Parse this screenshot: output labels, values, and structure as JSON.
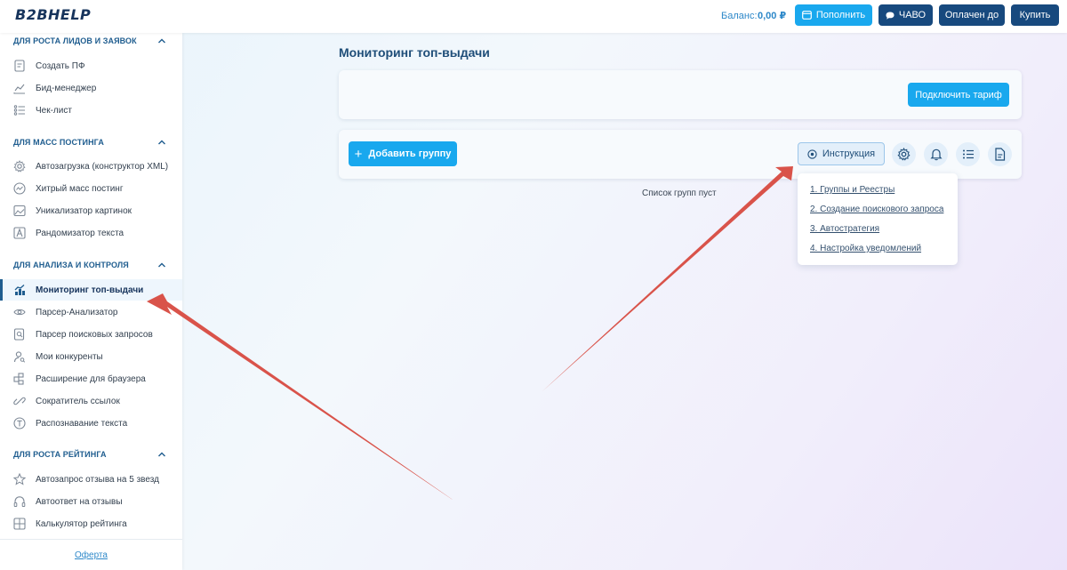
{
  "header": {
    "logo": "B2BHELP",
    "balance_label": "Баланс:",
    "balance_value": "0,00 ₽",
    "topup_label": "Пополнить",
    "faq_label": "ЧАВО",
    "paid_label": "Оплачен до",
    "buy_label": "Купить"
  },
  "sidebar": {
    "sections": [
      {
        "title": "ДЛЯ РОСТА ЛИДОВ И ЗАЯВОК",
        "items": [
          {
            "label": "Создать ПФ",
            "icon": "document-icon"
          },
          {
            "label": "Бид-менеджер",
            "icon": "chart-line-icon"
          },
          {
            "label": "Чек-лист",
            "icon": "checklist-icon"
          }
        ]
      },
      {
        "title": "ДЛЯ МАСС ПОСТИНГА",
        "items": [
          {
            "label": "Автозагрузка (конструктор XML)",
            "icon": "gear-icon"
          },
          {
            "label": "Хитрый масс постинг",
            "icon": "pulse-icon"
          },
          {
            "label": "Уникализатор картинок",
            "icon": "image-icon"
          },
          {
            "label": "Рандомизатор текста",
            "icon": "letter-a-icon"
          }
        ]
      },
      {
        "title": "ДЛЯ АНАЛИЗА И КОНТРОЛЯ",
        "items": [
          {
            "label": "Мониторинг топ-выдачи",
            "icon": "monitoring-icon",
            "active": true
          },
          {
            "label": "Парсер-Анализатор",
            "icon": "eye-icon"
          },
          {
            "label": "Парсер поисковых запросов",
            "icon": "search-document-icon"
          },
          {
            "label": "Мои конкуренты",
            "icon": "user-search-icon"
          },
          {
            "label": "Расширение для браузера",
            "icon": "puzzle-icon"
          },
          {
            "label": "Сократитель ссылок",
            "icon": "link-icon"
          },
          {
            "label": "Распознавание текста",
            "icon": "letter-t-icon"
          }
        ]
      },
      {
        "title": "ДЛЯ РОСТА РЕЙТИНГА",
        "items": [
          {
            "label": "Автозапрос отзыва на 5 звезд",
            "icon": "star-icon"
          },
          {
            "label": "Автоответ на отзывы",
            "icon": "headphones-icon"
          },
          {
            "label": "Калькулятор рейтинга",
            "icon": "calculator-icon"
          }
        ]
      }
    ],
    "offer_link": "Оферта"
  },
  "main": {
    "title": "Мониторинг топ-выдачи",
    "connect_plan_label": "Подключить тариф",
    "add_group_label": "Добавить группу",
    "instruction_label": "Инструкция",
    "empty_text": "Список групп пуст",
    "instruction_menu": [
      "1. Группы и Реестры",
      "2. Создание поискового запроса",
      "3. Автостратегия",
      "4. Настройка уведомлений"
    ]
  },
  "colors": {
    "primary": "#19a8ee",
    "dark": "#17497e",
    "accent_text": "#1f4e79",
    "annotation_arrow": "#d9534a"
  }
}
